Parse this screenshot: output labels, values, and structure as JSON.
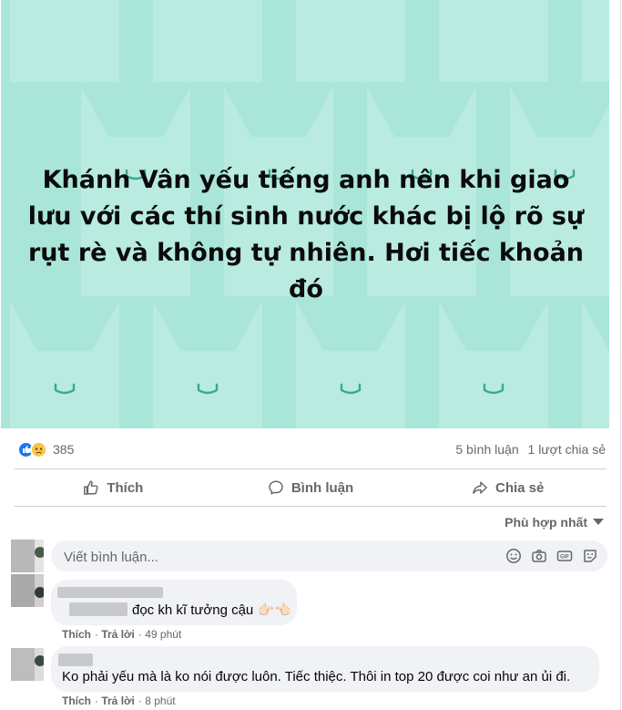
{
  "post": {
    "text": "Khánh Vân yếu tiếng anh nên khi giao lưu với các thí sinh nước khác bị lộ rõ sự rụt rè và không tự nhiên. Hơi tiếc khoản đó",
    "background_color": "#a9e6d9",
    "pattern_color": "#c6efe6",
    "accent_color": "#3aa892"
  },
  "reactions": {
    "icons": [
      "like-reaction-icon",
      "sad-reaction-icon"
    ],
    "count": "385",
    "comments": "5 bình luận",
    "shares": "1 lượt chia sẻ"
  },
  "actions": {
    "like": "Thích",
    "comment": "Bình luận",
    "share": "Chia sẻ"
  },
  "sort": {
    "label": "Phù hợp nhất"
  },
  "composer": {
    "placeholder": "Viết bình luận..."
  },
  "comments": [
    {
      "text": "đọc kh kĩ tưởng cậu 👉🏻👈🏻",
      "like": "Thích",
      "reply": "Trả lời",
      "time": "49 phút"
    },
    {
      "text": "Ko phải yếu mà là ko nói được luôn. Tiếc thiệc. Thôi in top 20 được coi như an ủi đi.",
      "like": "Thích",
      "reply": "Trả lời",
      "time": "8 phút"
    }
  ],
  "colors": {
    "muted": "#65676b",
    "link_blue": "#1877f2",
    "bubble": "#f0f2f5"
  }
}
